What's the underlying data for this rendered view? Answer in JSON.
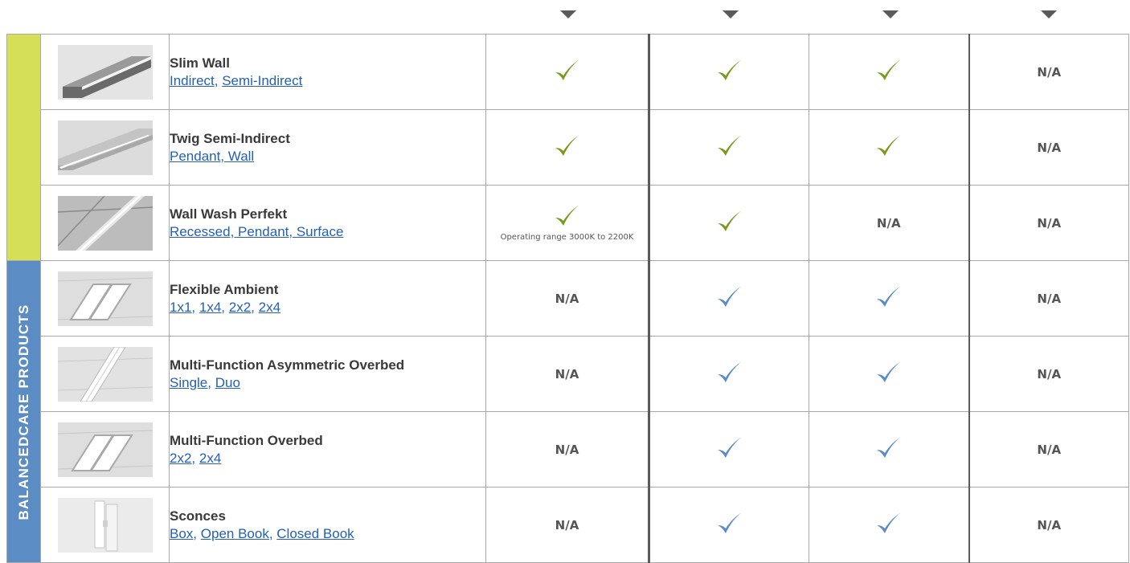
{
  "categories": [
    {
      "label": "",
      "color": "#d6df58"
    },
    {
      "label": "BALANCEDCARE PRODUCTS",
      "color": "#5b8dc4"
    }
  ],
  "colors": {
    "green_check": "#7a9a1e",
    "blue_check": "#5b8dc4",
    "link": "#2460b3"
  },
  "na_text": "N/A",
  "rows": [
    {
      "name": "Slim Wall",
      "links": [
        "Indirect",
        "Semi-Indirect"
      ],
      "image": "slim-wall-thumbnail",
      "cells": [
        {
          "type": "check",
          "color": "green"
        },
        {
          "type": "check",
          "color": "green"
        },
        {
          "type": "check",
          "color": "green"
        },
        {
          "type": "na"
        }
      ]
    },
    {
      "name": "Twig Semi-Indirect",
      "links": [
        "Pendant, Wall"
      ],
      "image": "twig-semi-indirect-thumbnail",
      "cells": [
        {
          "type": "check",
          "color": "green"
        },
        {
          "type": "check",
          "color": "green"
        },
        {
          "type": "check",
          "color": "green"
        },
        {
          "type": "na"
        }
      ]
    },
    {
      "name": "Wall Wash Perfekt",
      "links": [
        "Recessed, Pendant, Surface"
      ],
      "image": "wall-wash-perfekt-thumbnail",
      "cells": [
        {
          "type": "check",
          "color": "green",
          "note": "Operating range 3000K to 2200K"
        },
        {
          "type": "check",
          "color": "green"
        },
        {
          "type": "na"
        },
        {
          "type": "na"
        }
      ]
    },
    {
      "name": "Flexible Ambient",
      "links": [
        "1x1,",
        "1x4,",
        "2x2,",
        "2x4"
      ],
      "image": "flexible-ambient-thumbnail",
      "cells": [
        {
          "type": "na"
        },
        {
          "type": "check",
          "color": "blue"
        },
        {
          "type": "check",
          "color": "blue"
        },
        {
          "type": "na"
        }
      ]
    },
    {
      "name": "Multi-Function Asymmetric Overbed",
      "links": [
        "Single,",
        "Duo"
      ],
      "image": "asymmetric-overbed-thumbnail",
      "cells": [
        {
          "type": "na"
        },
        {
          "type": "check",
          "color": "blue"
        },
        {
          "type": "check",
          "color": "blue"
        },
        {
          "type": "na"
        }
      ]
    },
    {
      "name": "Multi-Function Overbed",
      "links": [
        "2x2,",
        "2x4"
      ],
      "image": "multi-function-overbed-thumbnail",
      "cells": [
        {
          "type": "na"
        },
        {
          "type": "check",
          "color": "blue"
        },
        {
          "type": "check",
          "color": "blue"
        },
        {
          "type": "na"
        }
      ]
    },
    {
      "name": "Sconces",
      "links": [
        "Box,",
        "Open Book,",
        "Closed Book"
      ],
      "image": "sconces-thumbnail",
      "cells": [
        {
          "type": "na"
        },
        {
          "type": "check",
          "color": "blue"
        },
        {
          "type": "check",
          "color": "blue"
        },
        {
          "type": "na"
        }
      ]
    }
  ]
}
